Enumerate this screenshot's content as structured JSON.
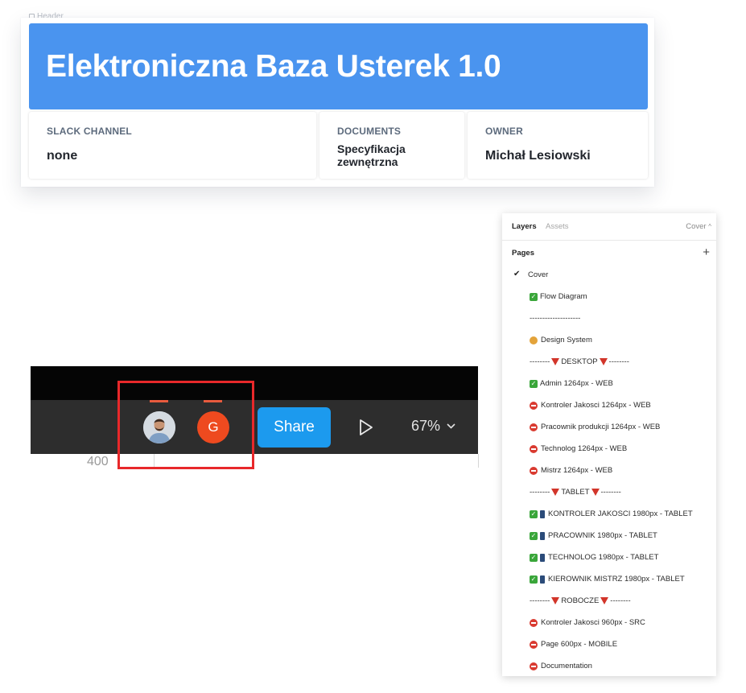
{
  "header": {
    "frame_label": "Header",
    "title": "Elektroniczna Baza Usterek 1.0",
    "fields": [
      {
        "label": "SLACK CHANNEL",
        "value": "none"
      },
      {
        "label": "DOCUMENTS",
        "value": "Specyfikacja zewnętrzna"
      },
      {
        "label": "OWNER",
        "value": "Michał Lesiowski"
      }
    ],
    "colors": {
      "banner": "#4a94ef"
    }
  },
  "toolbar": {
    "avatar_letter": "G",
    "share_label": "Share",
    "zoom": "67%",
    "ruler_value": "400",
    "colors": {
      "share": "#1c9aee",
      "avatar_g": "#ee4a1f",
      "highlight": "#e8282a"
    }
  },
  "panel": {
    "tabs": {
      "layers": "Layers",
      "assets": "Assets",
      "current_page": "Cover"
    },
    "pages_label": "Pages",
    "add_icon": "+",
    "pages": [
      {
        "label": "Cover",
        "active": true
      },
      {
        "label": "Flow Diagram",
        "emoji": "check"
      },
      {
        "label": "--------------------"
      },
      {
        "label": "Design System",
        "emoji": "palette"
      },
      {
        "label": "DESKTOP",
        "divider": true
      },
      {
        "label": "Admin 1264px - WEB",
        "emoji": "check"
      },
      {
        "label": "Kontroler Jakosci 1264px - WEB",
        "emoji": "stop"
      },
      {
        "label": "Pracownik produkcji 1264px - WEB",
        "emoji": "stop"
      },
      {
        "label": "Technolog 1264px - WEB",
        "emoji": "stop"
      },
      {
        "label": "Mistrz 1264px - WEB",
        "emoji": "stop"
      },
      {
        "label": "TABLET",
        "divider": true
      },
      {
        "label": "KONTROLER JAKOSCI 1980px - TABLET",
        "emoji": "check-phone"
      },
      {
        "label": "PRACOWNIK 1980px - TABLET",
        "emoji": "check-phone"
      },
      {
        "label": "TECHNOLOG 1980px - TABLET",
        "emoji": "check-phone"
      },
      {
        "label": "KIEROWNIK MISTRZ 1980px - TABLET",
        "emoji": "check-phone"
      },
      {
        "label": "ROBOCZE",
        "divider": true
      },
      {
        "label": "Kontroler Jakosci 960px -  SRC",
        "emoji": "stop"
      },
      {
        "label": "Page 600px - MOBILE",
        "emoji": "stop"
      },
      {
        "label": "Documentation",
        "emoji": "stop"
      }
    ]
  }
}
